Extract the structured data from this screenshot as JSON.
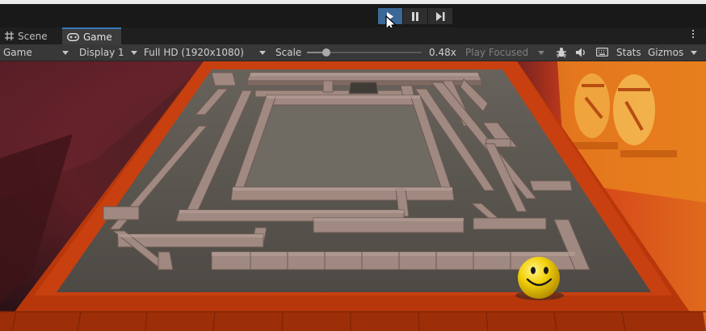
{
  "playmode": {
    "play_icon": "play-icon",
    "pause_icon": "pause-icon",
    "step_icon": "step-icon",
    "play_active": true
  },
  "tabs": [
    {
      "label": "Scene",
      "icon": "grid-icon"
    },
    {
      "label": "Game",
      "icon": "gamepad-icon",
      "active": true
    }
  ],
  "controls": {
    "view_select": "Game",
    "display_select": "Display 1",
    "resolution_select": "Full HD (1920x1080)",
    "scale_label": "Scale",
    "scale_value": "0.48x",
    "play_focused": "Play Focused",
    "stats_label": "Stats",
    "gizmos_label": "Gizmos",
    "icons": [
      "bug-icon",
      "speaker-icon",
      "keyboard-icon"
    ],
    "scale_level": 0.48
  },
  "colors": {
    "accent": "#3a79bb",
    "play_active_bg": "#3b6898",
    "toolbar_bg": "#191919",
    "control_bar_bg": "#383838",
    "maze_floor": "#5a5650",
    "maze_wall": "#a08a80",
    "maze_border": "#c23a08",
    "ball": "#f2d10c",
    "background_red": "#8a1a16"
  }
}
